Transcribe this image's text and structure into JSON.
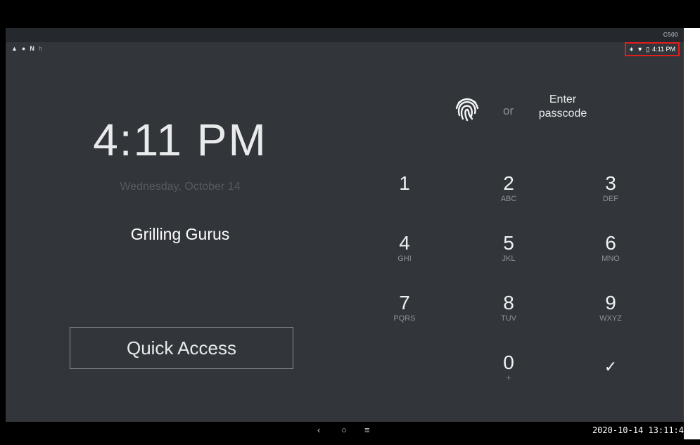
{
  "camera_overlay": {
    "label": "C500"
  },
  "status_bar": {
    "time": "4:11 PM",
    "notification_icons": [
      "warning-icon",
      "fire-icon",
      "n-icon",
      "small-icon"
    ],
    "system_icons": [
      "bluetooth-icon",
      "wifi-icon",
      "battery-icon"
    ]
  },
  "lockscreen": {
    "clock": "4:11 PM",
    "date": "Wednesday, October 14",
    "owner_info": "Grilling Gurus",
    "quick_access_label": "Quick Access",
    "unlock_or": "or",
    "unlock_prompt_line1": "Enter",
    "unlock_prompt_line2": "passcode"
  },
  "keypad": {
    "keys": [
      {
        "digit": "1",
        "letters": ""
      },
      {
        "digit": "2",
        "letters": "ABC"
      },
      {
        "digit": "3",
        "letters": "DEF"
      },
      {
        "digit": "4",
        "letters": "GHI"
      },
      {
        "digit": "5",
        "letters": "JKL"
      },
      {
        "digit": "6",
        "letters": "MNO"
      },
      {
        "digit": "7",
        "letters": "PQRS"
      },
      {
        "digit": "8",
        "letters": "TUV"
      },
      {
        "digit": "9",
        "letters": "WXYZ"
      },
      {
        "digit": "0",
        "letters": "+"
      }
    ],
    "enter_symbol": "✓"
  },
  "nav_bar": {
    "back": "‹",
    "home": "○",
    "recents": "≡"
  },
  "recording_timestamp": "2020-10-14 13:11:4"
}
